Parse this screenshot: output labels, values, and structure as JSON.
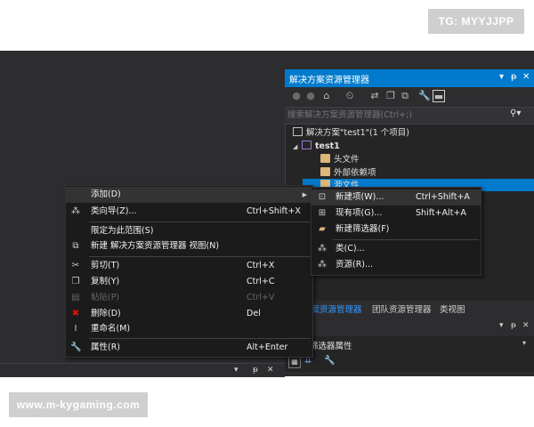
{
  "watermarks": {
    "top": "TG: MYYJJPP",
    "bottom": "www.m-kygaming.com"
  },
  "solution_explorer": {
    "title": "解决方案资源管理器",
    "title_icons": [
      "dropdown-icon",
      "pin-icon",
      "close-icon"
    ],
    "toolbar_icons": [
      "back-icon",
      "forward-icon",
      "home-icon",
      "history-icon",
      "sync-icon",
      "collapse-icon",
      "show-all-icon",
      "properties-icon",
      "preview-icon"
    ],
    "search_placeholder": "搜索解决方案资源管理器(Ctrl+;)",
    "tree": [
      {
        "label": "解决方案\"test1\"(1 个项目)",
        "icon": "solution-icon"
      },
      {
        "label": "test1",
        "icon": "project-icon"
      },
      {
        "label": "头文件",
        "icon": "folder-icon"
      },
      {
        "label": "外部依赖项",
        "icon": "folder-icon"
      },
      {
        "label": "源文件",
        "icon": "folder-icon",
        "selected": true
      }
    ],
    "tabs": [
      {
        "label": "方案资源管理器",
        "active": true
      },
      {
        "label": "团队资源管理器",
        "active": false
      },
      {
        "label": "类视图",
        "active": false
      }
    ]
  },
  "properties": {
    "row_label": "筛选器属性"
  },
  "context_menu": {
    "items": [
      {
        "label": "添加(D)",
        "shortcut": "",
        "icon": "",
        "submenu": true,
        "highlighted": true
      },
      {
        "label": "类向导(Z)...",
        "shortcut": "Ctrl+Shift+X",
        "icon": "class-wizard-icon"
      },
      {
        "label": "限定为此范围(S)",
        "shortcut": "",
        "icon": ""
      },
      {
        "label": "新建 解决方案资源管理器 视图(N)",
        "shortcut": "",
        "icon": "new-view-icon"
      },
      {
        "label": "剪切(T)",
        "shortcut": "Ctrl+X",
        "icon": "cut-icon"
      },
      {
        "label": "复制(Y)",
        "shortcut": "Ctrl+C",
        "icon": "copy-icon"
      },
      {
        "label": "粘贴(P)",
        "shortcut": "Ctrl+V",
        "icon": "paste-icon",
        "disabled": true
      },
      {
        "label": "删除(D)",
        "shortcut": "Del",
        "icon": "delete-icon"
      },
      {
        "label": "重命名(M)",
        "shortcut": "",
        "icon": "rename-icon"
      },
      {
        "label": "属性(R)",
        "shortcut": "Alt+Enter",
        "icon": "properties-icon"
      }
    ]
  },
  "submenu": {
    "items": [
      {
        "label": "新建项(W)...",
        "shortcut": "Ctrl+Shift+A",
        "icon": "new-item-icon",
        "highlighted": true
      },
      {
        "label": "现有项(G)...",
        "shortcut": "Shift+Alt+A",
        "icon": "existing-item-icon"
      },
      {
        "label": "新建筛选器(F)",
        "shortcut": "",
        "icon": "new-filter-icon"
      },
      {
        "label": "类(C)...",
        "shortcut": "",
        "icon": "class-icon"
      },
      {
        "label": "资源(R)...",
        "shortcut": "",
        "icon": "resource-icon"
      }
    ]
  },
  "colors": {
    "accent": "#007acc",
    "ide_background": "#2d2d30",
    "menu_background": "#1b1b1c",
    "delete_icon": "#e51400"
  }
}
